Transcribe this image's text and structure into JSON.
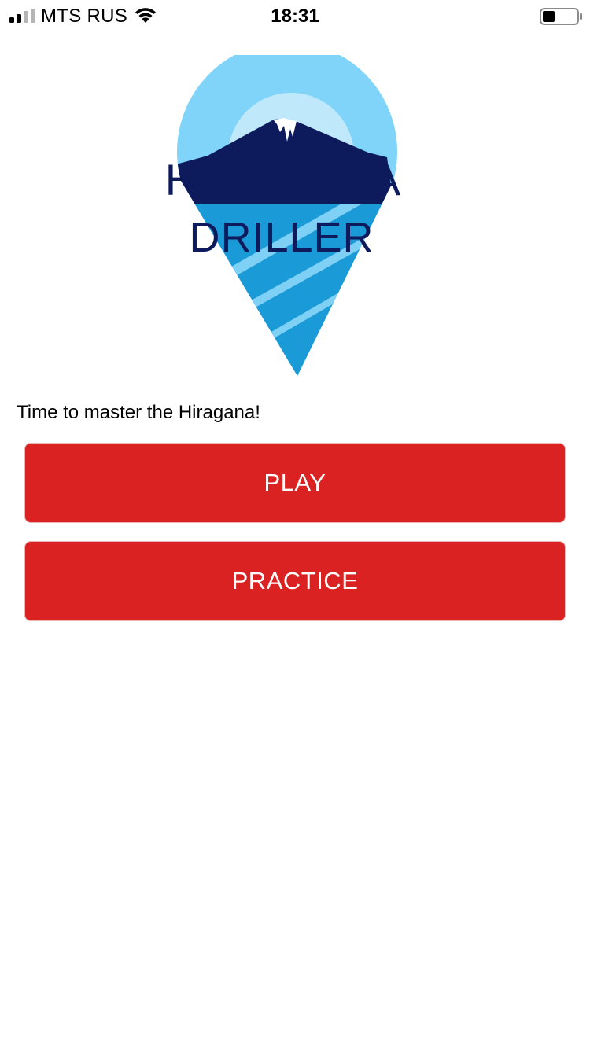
{
  "status_bar": {
    "carrier": "MTS RUS",
    "time": "18:31",
    "signal_bars_active": 2,
    "signal_bars_total": 4,
    "battery_level": 0.35,
    "icons": [
      "signal-icon",
      "wifi-icon",
      "battery-icon"
    ]
  },
  "logo": {
    "line1": "HIRAGANA",
    "line2": "DRILLER",
    "colors": {
      "pin_top": "#80d4fa",
      "sun": "#bfe9fb",
      "mountain": "#0d1a5c",
      "pin_bottom": "#1a9ad6",
      "stripes": "#7fd0f5",
      "text": "#0d1a5c"
    }
  },
  "main": {
    "tagline": "Time to master the Hiragana!",
    "play_label": "PLAY",
    "practice_label": "PRACTICE"
  },
  "colors": {
    "button_bg": "#da2222",
    "button_text": "#ffffff",
    "background": "#ffffff"
  }
}
